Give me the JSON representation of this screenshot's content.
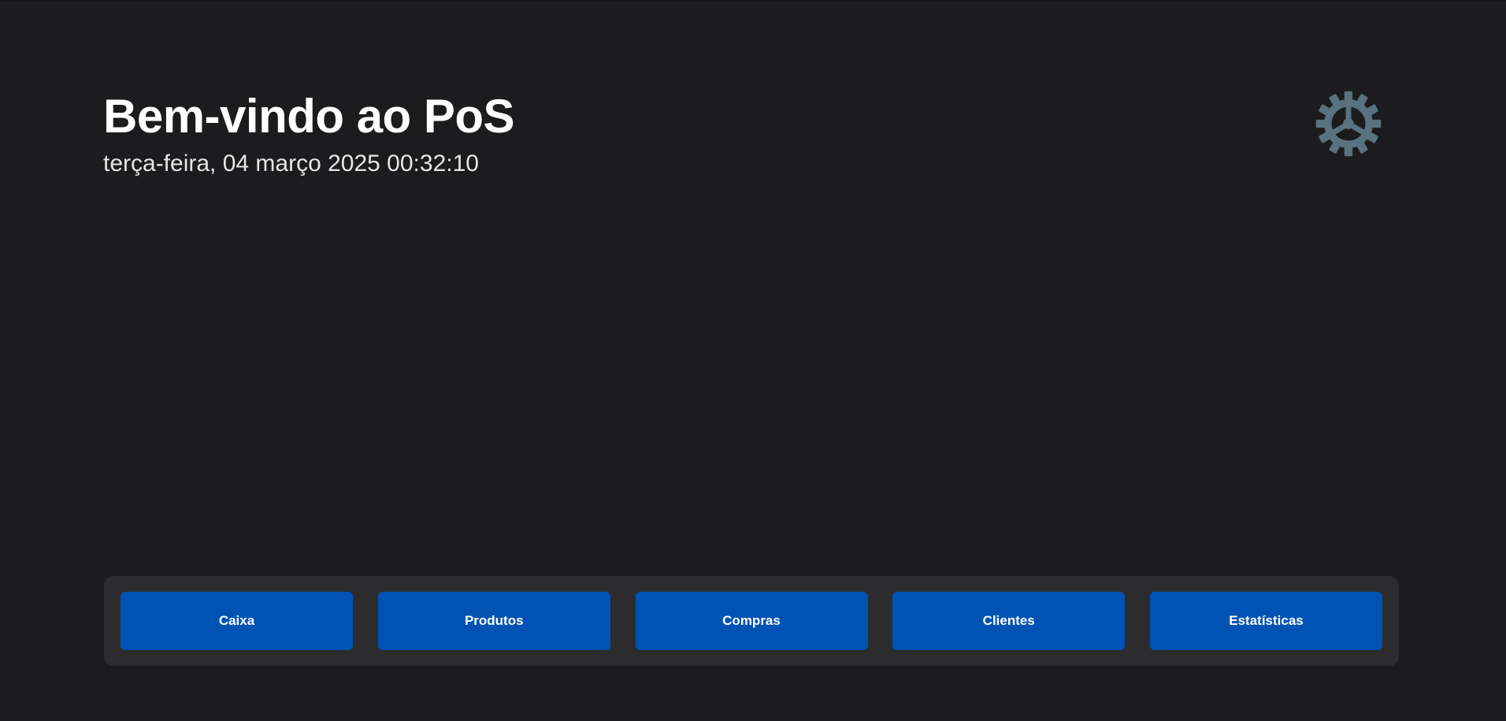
{
  "header": {
    "title": "Bem-vindo ao PoS",
    "datetime": "terça-feira, 04 março 2025 00:32:10"
  },
  "settings": {
    "icon": "gear-icon",
    "color": "#58727f"
  },
  "nav": {
    "buttons": [
      {
        "label": "Caixa"
      },
      {
        "label": "Produtos"
      },
      {
        "label": "Compras"
      },
      {
        "label": "Clientes"
      },
      {
        "label": "Estatísticas"
      }
    ]
  },
  "colors": {
    "background": "#1c1c1e",
    "panel": "#2c2c2e",
    "accent": "#0053b4",
    "text": "#ffffff"
  }
}
